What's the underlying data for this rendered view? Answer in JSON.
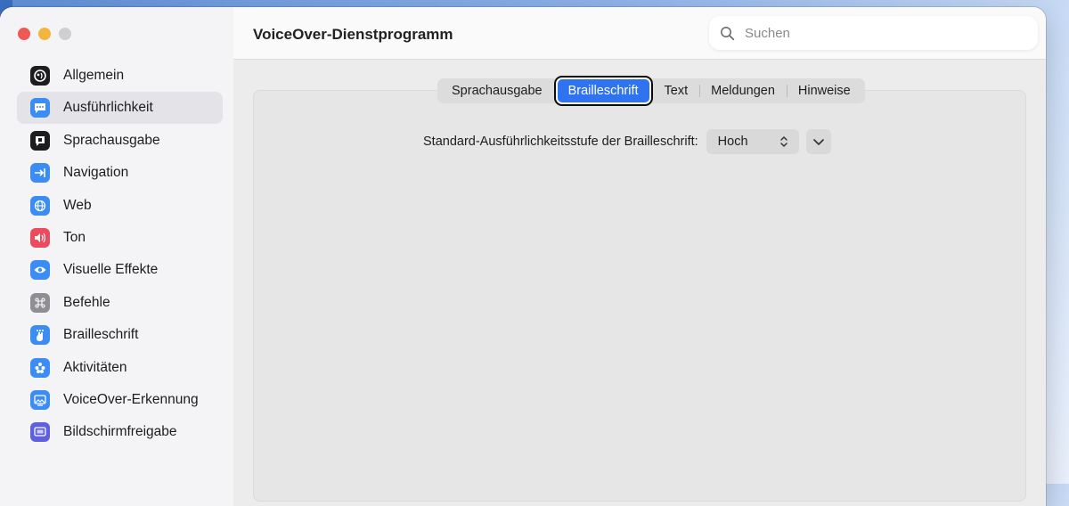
{
  "window": {
    "title": "VoiceOver-Dienstprogramm"
  },
  "search": {
    "placeholder": "Suchen"
  },
  "sidebar": {
    "items": [
      {
        "label": "Allgemein",
        "icon": "voiceover-icon",
        "color": "#1d1d1f"
      },
      {
        "label": "Ausführlichkeit",
        "icon": "speech-bubble-icon",
        "color": "#3b8cf5"
      },
      {
        "label": "Sprachausgabe",
        "icon": "speech-icon",
        "color": "#1d1d1f"
      },
      {
        "label": "Navigation",
        "icon": "arrow-right-to-line-icon",
        "color": "#3b8cf5"
      },
      {
        "label": "Web",
        "icon": "globe-icon",
        "color": "#3b8cf5"
      },
      {
        "label": "Ton",
        "icon": "speaker-icon",
        "color": "#ec4a5d"
      },
      {
        "label": "Visuelle Effekte",
        "icon": "eye-icon",
        "color": "#3b8cf5"
      },
      {
        "label": "Befehle",
        "icon": "command-icon",
        "color": "#8e8e93"
      },
      {
        "label": "Brailleschrift",
        "icon": "braille-hand-icon",
        "color": "#3b8cf5"
      },
      {
        "label": "Aktivitäten",
        "icon": "activities-icon",
        "color": "#3b8cf5"
      },
      {
        "label": "VoiceOver-Erkennung",
        "icon": "recognition-icon",
        "color": "#3b8cf5"
      },
      {
        "label": "Bildschirmfreigabe",
        "icon": "screen-sharing-icon",
        "color": "#5f5fe0"
      }
    ],
    "selected": "Ausführlichkeit"
  },
  "tabs": [
    {
      "label": "Sprachausgabe"
    },
    {
      "label": "Brailleschrift"
    },
    {
      "label": "Text"
    },
    {
      "label": "Meldungen"
    },
    {
      "label": "Hinweise"
    }
  ],
  "active_tab": "Brailleschrift",
  "braille": {
    "verbosity_label": "Standard-Ausführlichkeitsstufe der Brailleschrift:",
    "verbosity_value": "Hoch"
  },
  "colors": {
    "accent": "#2f73f0",
    "close": "#ee5a53",
    "minimize": "#f3b53b",
    "maximize": "#cfcfd2"
  }
}
